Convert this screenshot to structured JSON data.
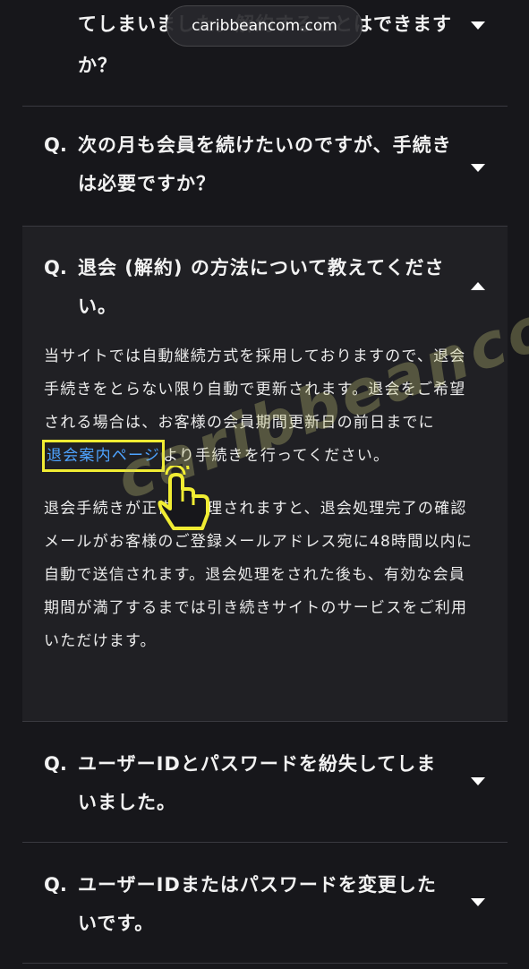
{
  "browser": {
    "url": "caribbeancom.com"
  },
  "faq": {
    "items": [
      {
        "prefix": "Q.",
        "question": "てしまいました。解約することはできますか？",
        "expanded": false
      },
      {
        "prefix": "Q.",
        "question": "次の月も会員を続けたいのですが、手続きは必要ですか？",
        "expanded": false
      },
      {
        "prefix": "Q.",
        "question": "退会 (解約) の方法について教えてください。",
        "expanded": true,
        "answer": {
          "p1_before": "当サイトでは自動継続方式を採用しておりますので、退会手続きをとらない限り自動で更新されます。退会をご希望される場合は、お客様の会員期間更新日の前日までに",
          "p1_link": "退会案内ページ",
          "p1_after": "より手続きを行ってください。",
          "p2": "退会手続きが正常に処理されますと、退会処理完了の確認メールがお客様のご登録メールアドレス宛に48時間以内に自動で送信されます。退会処理をされた後も、有効な会員期間が満了するまでは引き続きサイトのサービスをご利用いただけます。"
        }
      },
      {
        "prefix": "Q.",
        "question": "ユーザーIDとパスワードを紛失してしまいました。",
        "expanded": false
      },
      {
        "prefix": "Q.",
        "question": "ユーザーIDまたはパスワードを変更したいです。",
        "expanded": false
      }
    ]
  },
  "overlay": {
    "watermark": "caribbeancom-cou",
    "pointer_icon": "hand-pointer-icon",
    "highlight_color": "#f0ec33",
    "link_color": "#4ea3ff"
  }
}
